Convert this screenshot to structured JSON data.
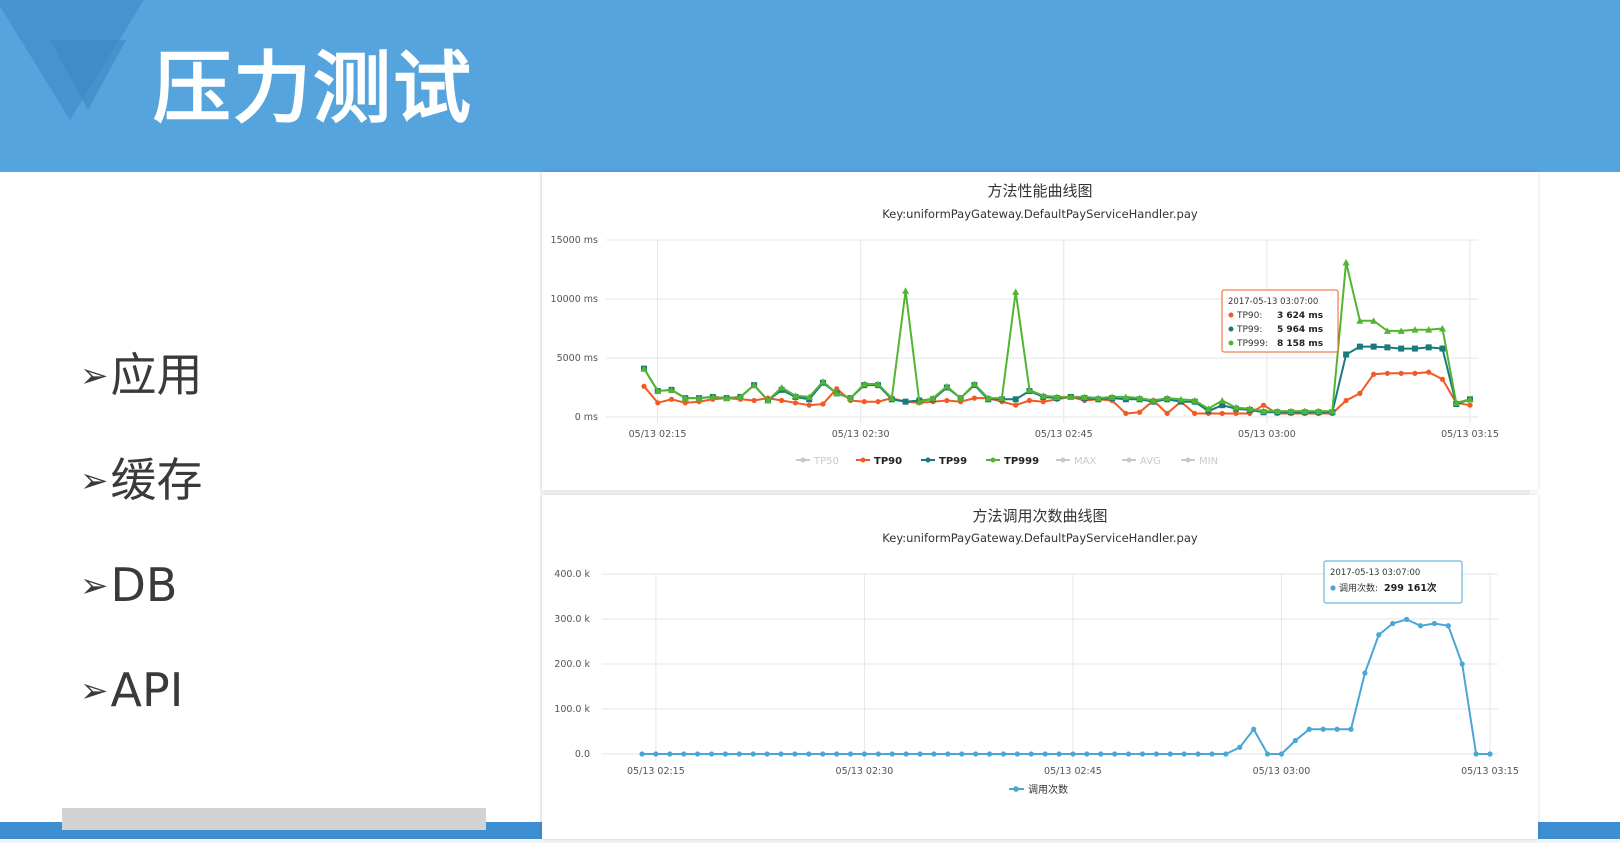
{
  "slide": {
    "title": "压力测试",
    "bullets": [
      {
        "marker": "➢",
        "text": "应用"
      },
      {
        "marker": "➢",
        "text": "缓存"
      },
      {
        "marker": "➢",
        "text": "DB"
      },
      {
        "marker": "➢",
        "text": "API"
      }
    ]
  },
  "colors": {
    "header": "#55a4dd",
    "tp90": "#f15a24",
    "tp99": "#1a7a7a",
    "tp999": "#52b531",
    "calls": "#4aa6d6"
  },
  "chart_data": [
    {
      "type": "line",
      "title": "方法性能曲线图",
      "subtitle": "Key:uniformPayGateway.DefaultPayServiceHandler.pay",
      "y_unit": "ms",
      "ylim": [
        0,
        15000
      ],
      "y_ticks": [
        "15000 ms",
        "10000 ms",
        "5000 ms",
        "0 ms"
      ],
      "x_ticks": [
        "05/13 02:15",
        "05/13 02:30",
        "05/13 02:45",
        "05/13 03:00",
        "05/13 03:15"
      ],
      "x_start_minute": 14,
      "x_end_minute": 75,
      "legend": [
        "TP50",
        "TP90",
        "TP99",
        "TP999",
        "MAX",
        "AVG",
        "MIN"
      ],
      "legend_active": [
        "TP90",
        "TP99",
        "TP999"
      ],
      "series": [
        {
          "name": "TP90",
          "values": [
            2600,
            1200,
            1500,
            1200,
            1300,
            1500,
            1600,
            1500,
            1400,
            1600,
            1400,
            1200,
            1000,
            1100,
            2400,
            1400,
            1300,
            1300,
            1600,
            1300,
            1200,
            1300,
            1400,
            1300,
            1600,
            1600,
            1300,
            1000,
            1400,
            1300,
            1500,
            1700,
            1400,
            1500,
            1400,
            300,
            400,
            1400,
            300,
            1300,
            300,
            300,
            300,
            300,
            300,
            1000,
            300,
            300,
            300,
            300,
            300,
            1400,
            2000,
            3624,
            3700,
            3700,
            3700,
            3800,
            3200,
            1200,
            1000
          ]
        },
        {
          "name": "TP99",
          "values": [
            4100,
            2200,
            2300,
            1600,
            1600,
            1700,
            1600,
            1700,
            2700,
            1400,
            2300,
            1700,
            1500,
            2900,
            2000,
            1600,
            2700,
            2700,
            1500,
            1300,
            1400,
            1500,
            2500,
            1600,
            2700,
            1500,
            1500,
            1500,
            2200,
            1700,
            1600,
            1700,
            1600,
            1500,
            1600,
            1500,
            1500,
            1300,
            1500,
            1300,
            1300,
            500,
            1000,
            700,
            600,
            400,
            400,
            400,
            400,
            400,
            400,
            5300,
            5964,
            5964,
            5900,
            5800,
            5800,
            5900,
            5800,
            1100,
            1500
          ]
        },
        {
          "name": "TP999",
          "values": [
            4100,
            2200,
            2300,
            1600,
            1600,
            1700,
            1600,
            1700,
            2700,
            1400,
            2500,
            1800,
            1700,
            3000,
            2000,
            1600,
            2800,
            2800,
            1600,
            10700,
            1300,
            1600,
            2600,
            1600,
            2800,
            1600,
            1600,
            10600,
            2300,
            1800,
            1700,
            1700,
            1700,
            1600,
            1700,
            1700,
            1600,
            1400,
            1600,
            1500,
            1400,
            700,
            1400,
            800,
            700,
            500,
            500,
            500,
            500,
            500,
            500,
            13100,
            8158,
            8158,
            7300,
            7300,
            7400,
            7400,
            7500,
            1200,
            1500
          ]
        }
      ],
      "tooltip": {
        "time": "2017-05-13 03:07:00",
        "rows": [
          {
            "name": "TP90",
            "value": "3 624 ms"
          },
          {
            "name": "TP99",
            "value": "5 964 ms"
          },
          {
            "name": "TP999",
            "value": "8 158 ms"
          }
        ]
      }
    },
    {
      "type": "line",
      "title": "方法调用次数曲线图",
      "subtitle": "Key:uniformPayGateway.DefaultPayServiceHandler.pay",
      "y_unit": "k",
      "ylim": [
        0,
        400
      ],
      "y_ticks": [
        "400.0 k",
        "300.0 k",
        "200.0 k",
        "100.0 k",
        "0.0"
      ],
      "x_ticks": [
        "05/13 02:15",
        "05/13 02:30",
        "05/13 02:45",
        "05/13 03:00",
        "05/13 03:15"
      ],
      "x_start_minute": 14,
      "x_end_minute": 75,
      "legend": [
        "调用次数"
      ],
      "series": [
        {
          "name": "调用次数",
          "values": [
            0,
            0,
            0,
            0,
            0,
            0,
            0,
            0,
            0,
            0,
            0,
            0,
            0,
            0,
            0,
            0,
            0,
            0,
            0,
            0,
            0,
            0,
            0,
            0,
            0,
            0,
            0,
            0,
            0,
            0,
            0,
            0,
            0,
            0,
            0,
            0,
            0,
            0,
            0,
            0,
            0,
            0,
            0,
            15,
            55,
            0,
            0,
            30,
            55,
            55,
            55,
            55,
            180,
            265,
            290,
            299.161,
            285,
            290,
            285,
            200,
            0,
            0
          ]
        }
      ],
      "tooltip": {
        "time": "2017-05-13 03:07:00",
        "rows": [
          {
            "name": "调用次数",
            "value": "299 161次"
          }
        ]
      }
    }
  ]
}
